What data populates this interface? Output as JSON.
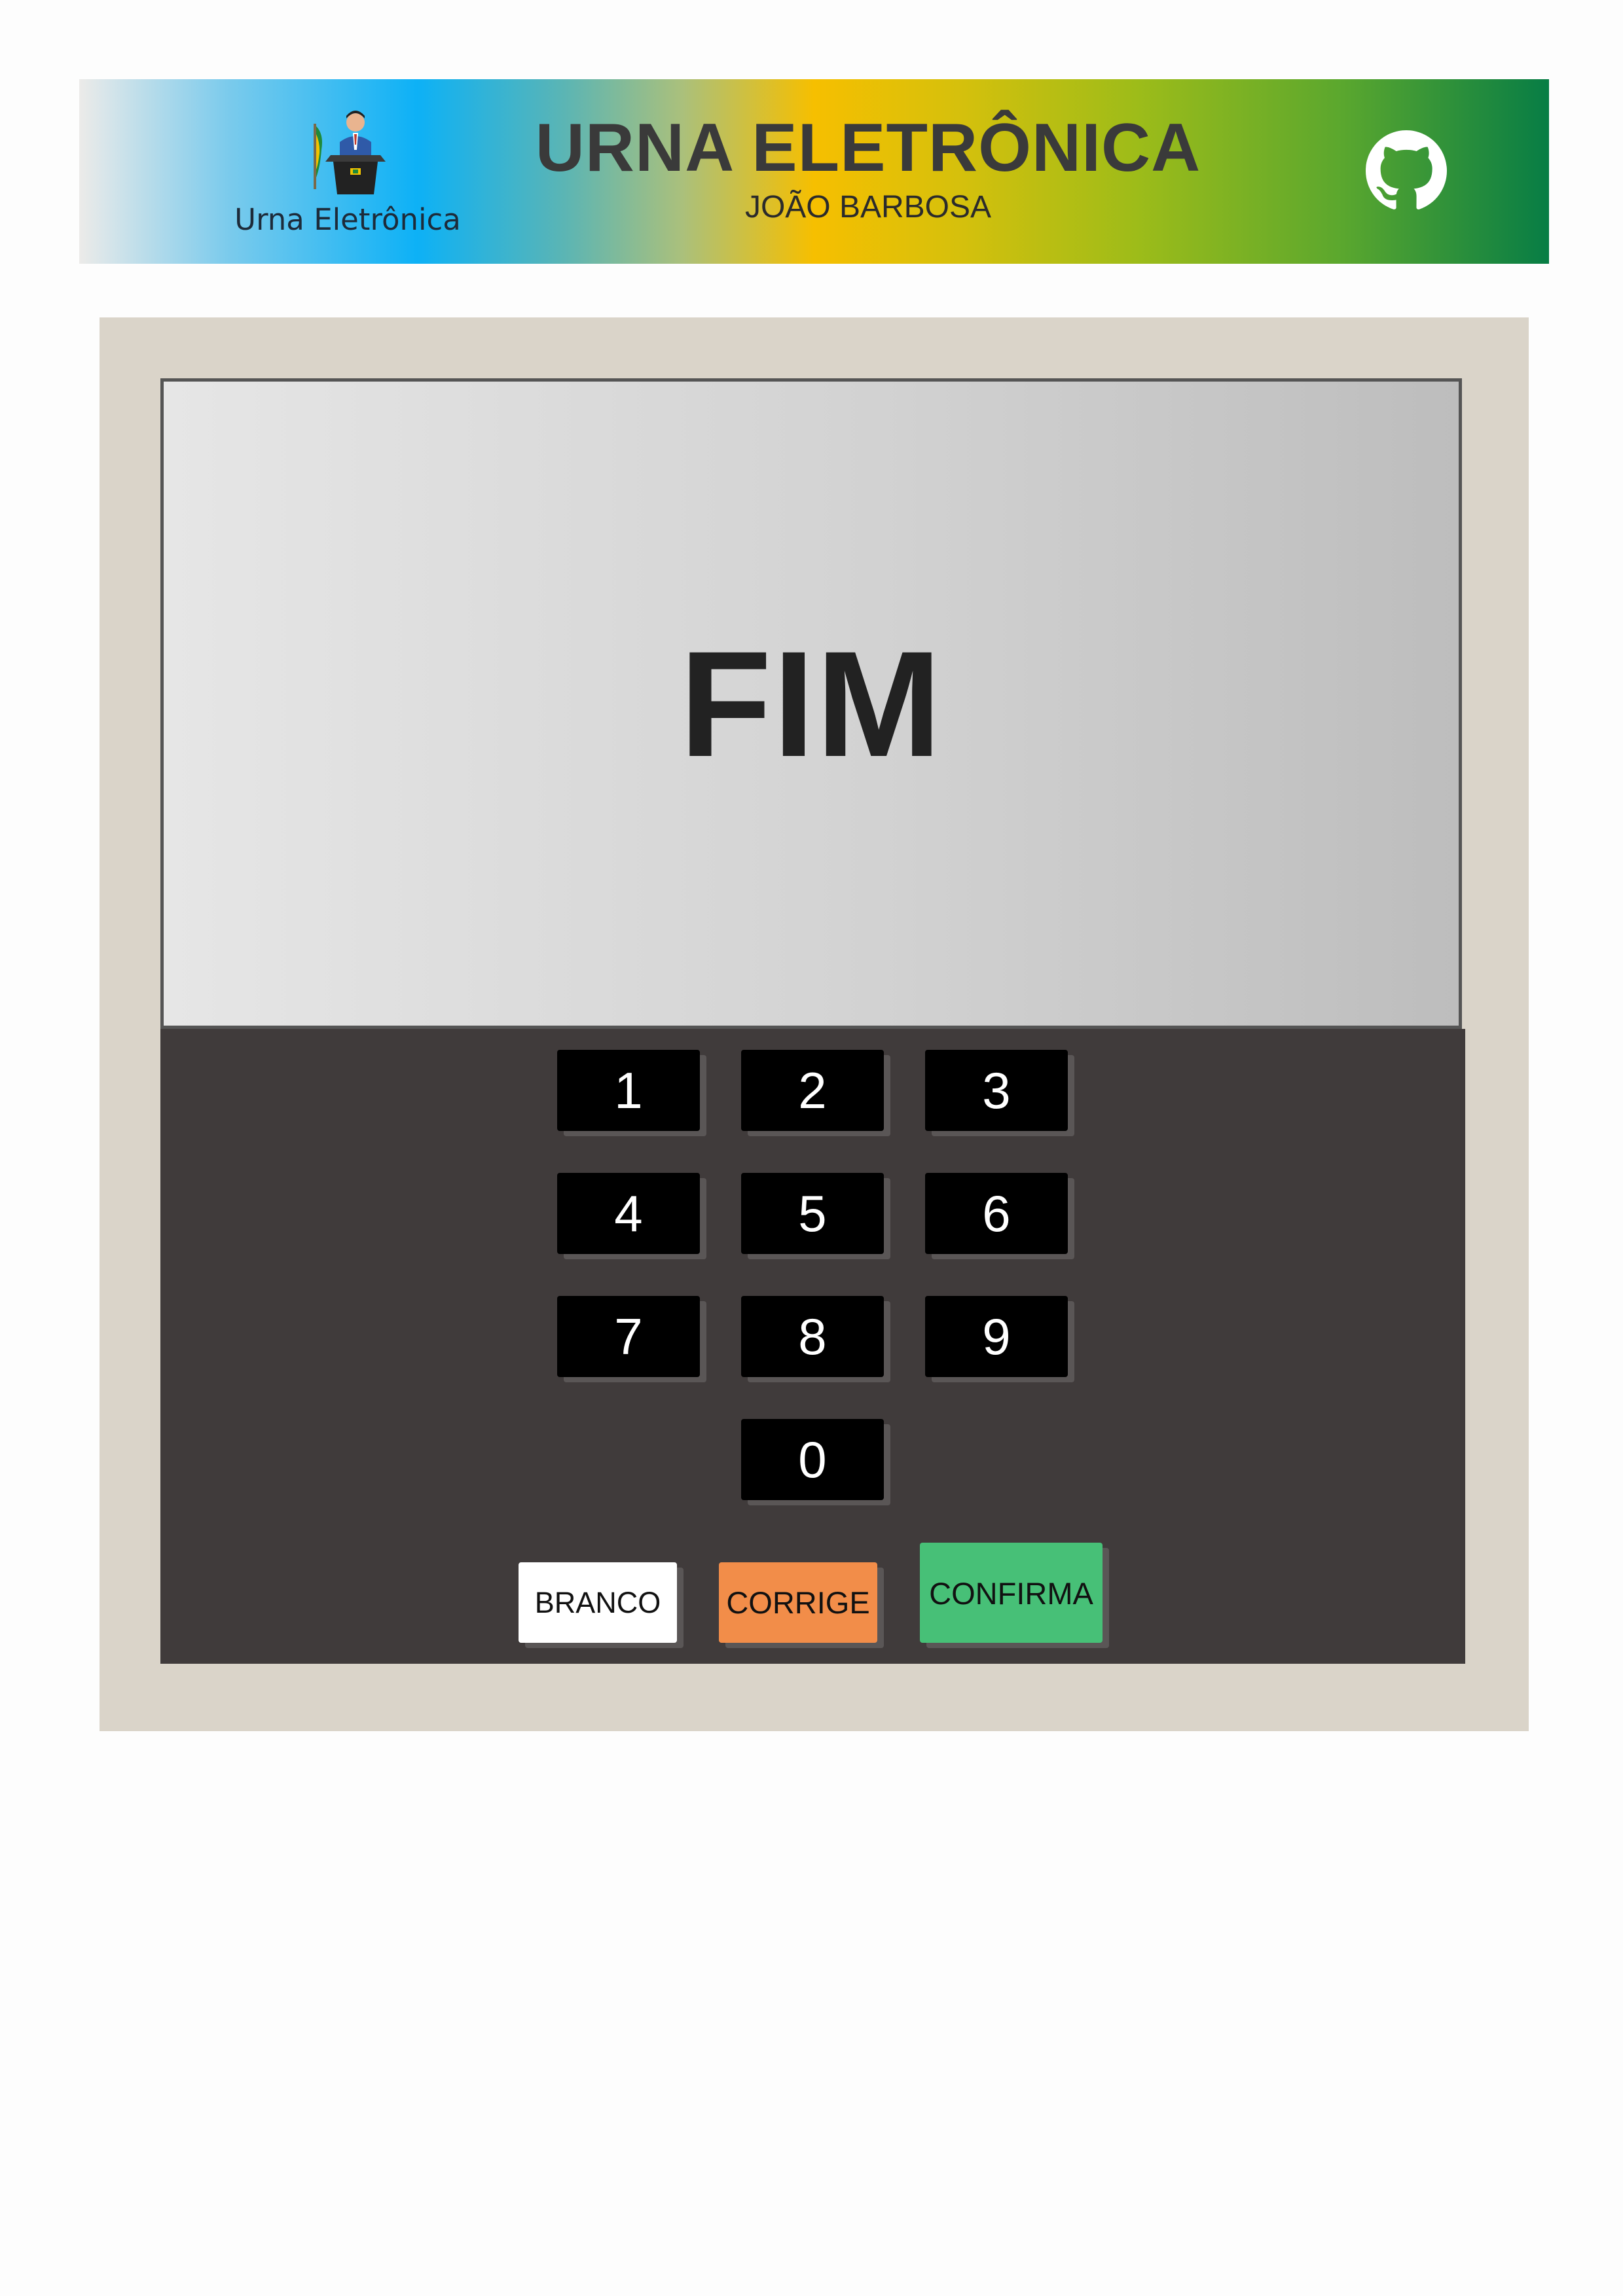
{
  "header": {
    "logo_text": "Urna Eletrônica",
    "title": "URNA ELETRÔNICA",
    "subtitle": "JOÃO BARBOSA",
    "github_icon": "github-icon"
  },
  "urna": {
    "screen_message": "FIM",
    "keys": [
      "1",
      "2",
      "3",
      "4",
      "5",
      "6",
      "7",
      "8",
      "9",
      "0"
    ],
    "actions": {
      "branco": "BRANCO",
      "corrige": "CORRIGE",
      "confirma": "CONFIRMA"
    }
  },
  "colors": {
    "branco": "#ffffff",
    "corrige": "#f28d49",
    "confirma": "#47c077",
    "keyboard": "#403b3b",
    "body": "#dad4c9"
  }
}
